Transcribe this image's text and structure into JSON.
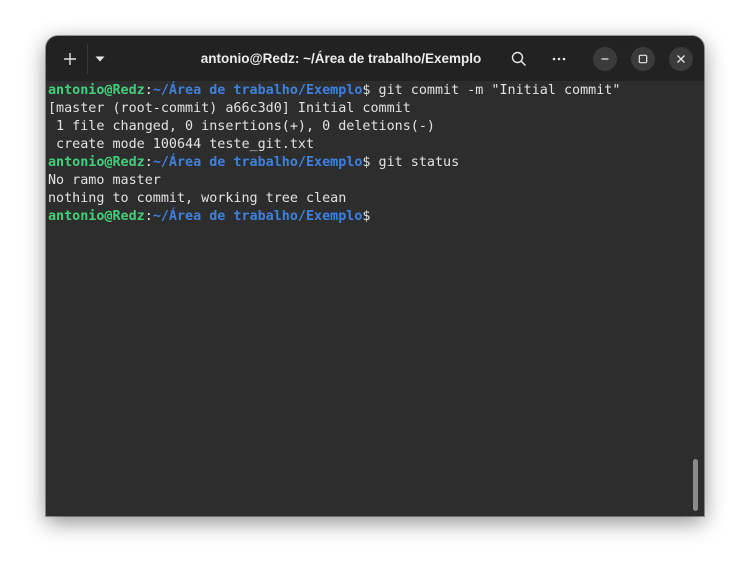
{
  "window": {
    "title": "antonio@Redz: ~/Área de trabalho/Exemplo"
  },
  "titlebar_icons": {
    "new_tab": "plus-icon",
    "menu": "chevron-down-icon",
    "search": "search-icon",
    "more": "ellipsis-icon",
    "minimize": "minimize-icon",
    "maximize": "maximize-icon",
    "close": "close-icon"
  },
  "colors": {
    "prompt_user": "#3fd07a",
    "prompt_path": "#3b82e0",
    "text": "#e2e2e2",
    "background": "#2d2d2d"
  },
  "terminal": {
    "line1": {
      "user": "antonio@Redz",
      "sep": ":",
      "path": "~/Área de trabalho/Exemplo",
      "cmd": "$ git commit -m \"Initial commit\""
    },
    "line2": "[master (root-commit) a66c3d0] Initial commit",
    "line3": " 1 file changed, 0 insertions(+), 0 deletions(-)",
    "line4": " create mode 100644 teste_git.txt",
    "line5": {
      "user": "antonio@Redz",
      "sep": ":",
      "path": "~/Área de trabalho/Exemplo",
      "cmd": "$ git status"
    },
    "line6": "No ramo master",
    "line7": "nothing to commit, working tree clean",
    "line8": {
      "user": "antonio@Redz",
      "sep": ":",
      "path": "~/Área de trabalho/Exemplo",
      "cmd": "$"
    }
  }
}
